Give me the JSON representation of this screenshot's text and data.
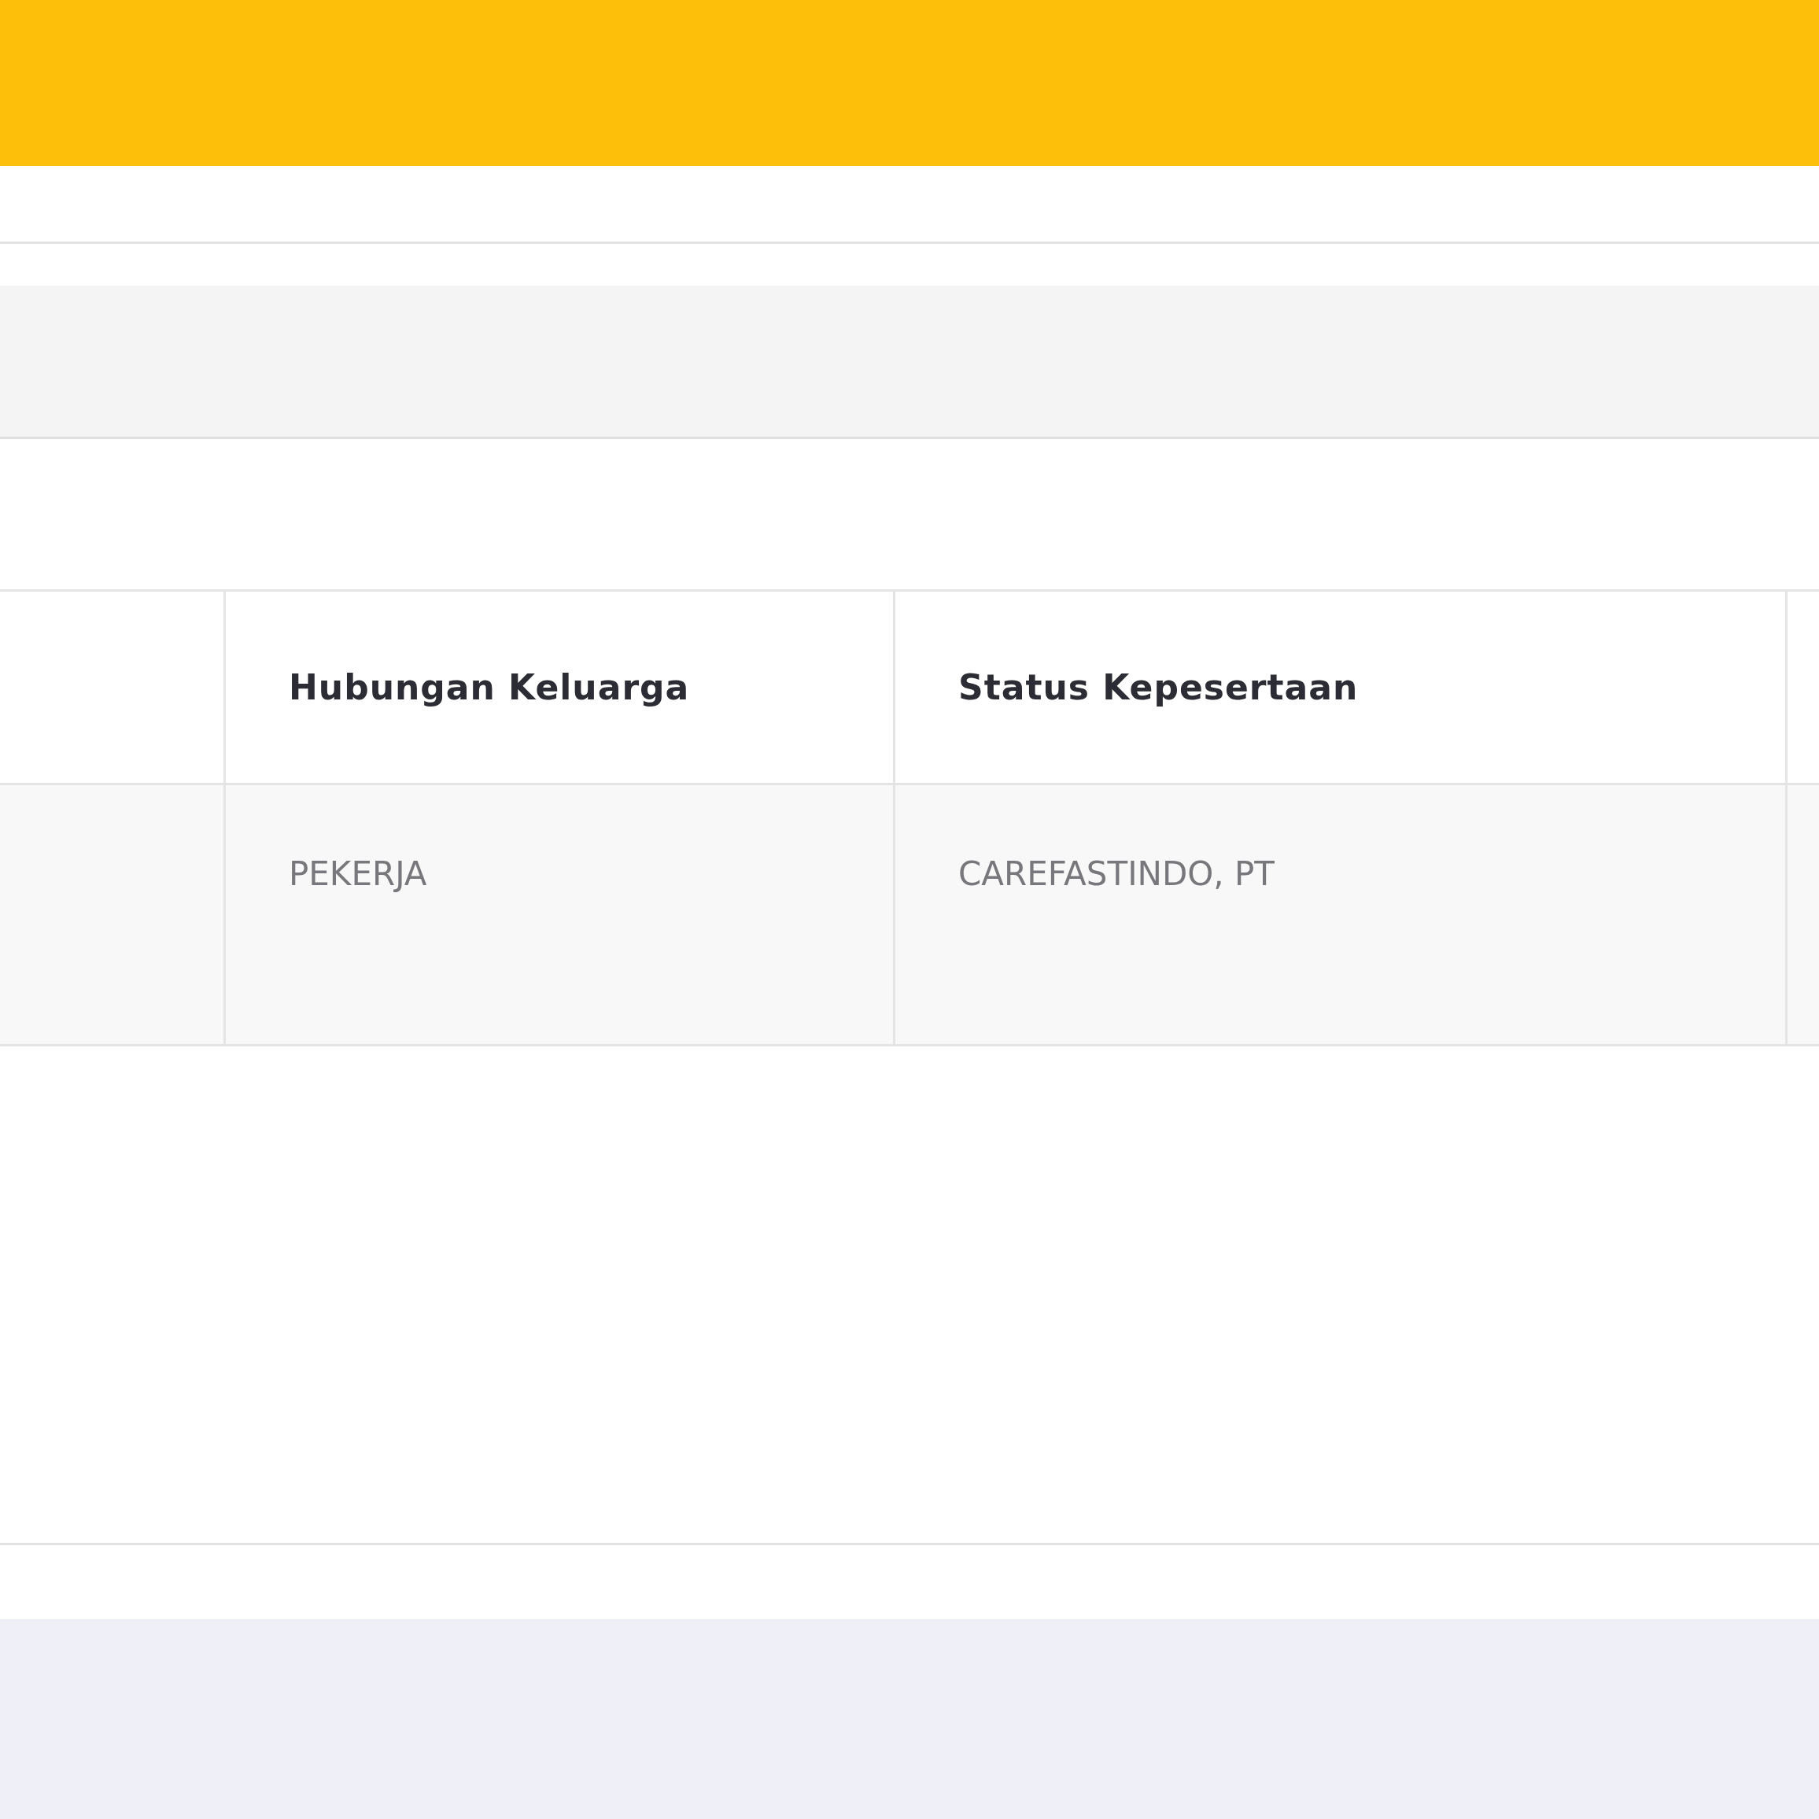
{
  "table": {
    "columns": [
      {
        "label": "Hubungan Keluarga"
      },
      {
        "label": "Status Kepesertaan"
      }
    ],
    "rows": [
      {
        "cells": [
          "PEKERJA",
          "CAREFASTINDO, PT"
        ]
      }
    ]
  }
}
